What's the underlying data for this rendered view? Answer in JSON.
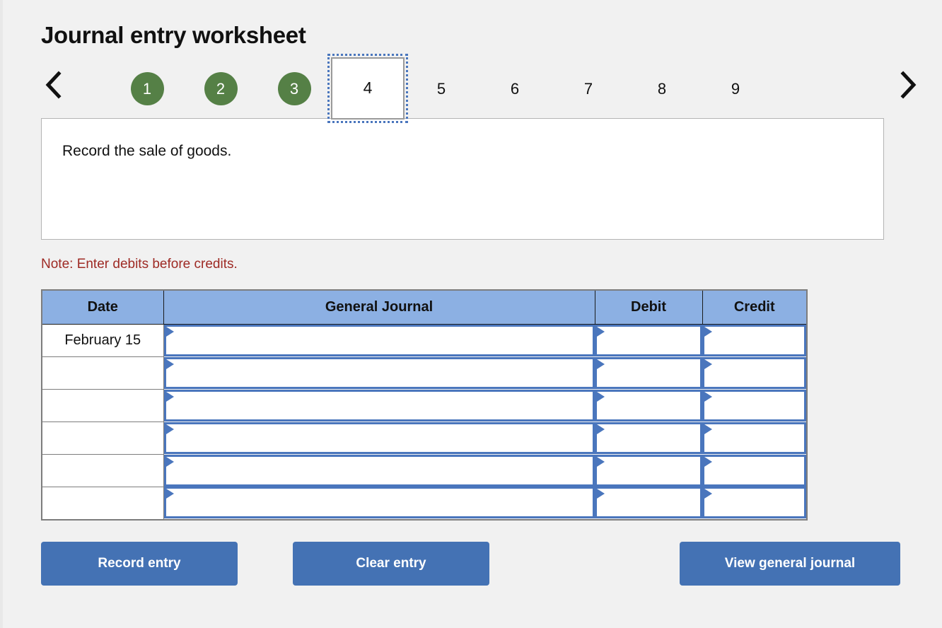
{
  "page": {
    "title": "Journal entry worksheet",
    "background": "#f1f1f1"
  },
  "stepper": {
    "prev_icon": "chevron-left-icon",
    "next_icon": "chevron-right-icon",
    "active_step": "4",
    "completed_color": "#558046",
    "active_outline_color": "#4a76bd",
    "steps": [
      {
        "label": "1",
        "state": "completed"
      },
      {
        "label": "2",
        "state": "completed"
      },
      {
        "label": "3",
        "state": "completed"
      },
      {
        "label": "4",
        "state": "active"
      },
      {
        "label": "5",
        "state": "upcoming"
      },
      {
        "label": "6",
        "state": "upcoming"
      },
      {
        "label": "7",
        "state": "upcoming"
      },
      {
        "label": "8",
        "state": "upcoming"
      },
      {
        "label": "9",
        "state": "upcoming"
      }
    ]
  },
  "prompt": {
    "text": "Record the sale of goods."
  },
  "note": {
    "text": "Note: Enter debits before credits.",
    "color": "#9e2a24"
  },
  "journal": {
    "header_color": "#8cb0e3",
    "columns": [
      "Date",
      "General Journal",
      "Debit",
      "Credit"
    ],
    "rows": [
      {
        "date": "February 15",
        "general_journal": "",
        "debit": "",
        "credit": ""
      },
      {
        "date": "",
        "general_journal": "",
        "debit": "",
        "credit": ""
      },
      {
        "date": "",
        "general_journal": "",
        "debit": "",
        "credit": ""
      },
      {
        "date": "",
        "general_journal": "",
        "debit": "",
        "credit": ""
      },
      {
        "date": "",
        "general_journal": "",
        "debit": "",
        "credit": ""
      },
      {
        "date": "",
        "general_journal": "",
        "debit": "",
        "credit": ""
      }
    ]
  },
  "buttons": {
    "color": "#4472b4",
    "record": "Record entry",
    "clear": "Clear entry",
    "view": "View general journal"
  }
}
